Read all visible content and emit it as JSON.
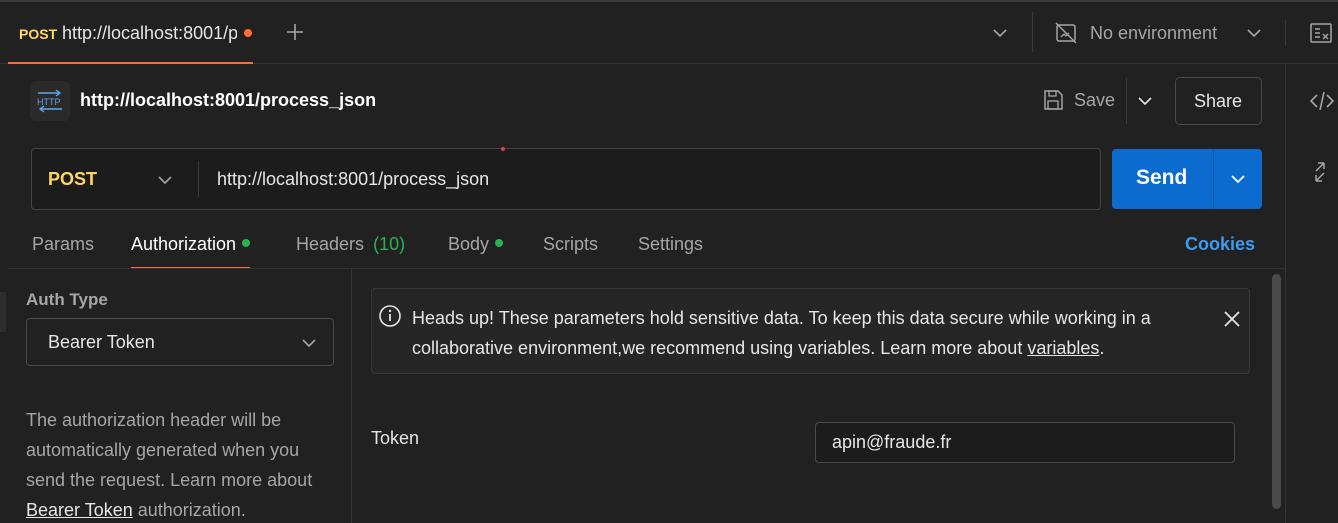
{
  "tabbar": {
    "tab_method": "POST",
    "tab_title": "http://localhost:8001/p",
    "environment_label": "No environment"
  },
  "request": {
    "title": "http://localhost:8001/process_json",
    "save_label": "Save",
    "share_label": "Share",
    "method": "POST",
    "url": "http://localhost:8001/process_json",
    "send_label": "Send"
  },
  "tabs": {
    "params": "Params",
    "authorization": "Authorization",
    "headers": "Headers",
    "headers_count": "(10)",
    "body": "Body",
    "scripts": "Scripts",
    "settings": "Settings",
    "cookies": "Cookies"
  },
  "auth": {
    "type_label": "Auth Type",
    "type_value": "Bearer Token",
    "desc_line1": "The authorization header will be",
    "desc_line2": "automatically generated when you",
    "desc_line3": "send the request. Learn more about",
    "desc_link": "Bearer Token",
    "desc_tail": " authorization."
  },
  "notice": {
    "line1": "Heads up! These parameters hold sensitive data. To keep this data secure while working in a",
    "line2": "collaborative environment,we recommend using variables. Learn more about ",
    "link": "variables",
    "end": "."
  },
  "token": {
    "label": "Token",
    "value": "apin@fraude.fr"
  },
  "colors": {
    "accent_orange": "#ff6c37",
    "send_blue": "#0b6bcf",
    "method_yellow": "#ffd666",
    "green_count": "#2bb24c",
    "cookies_blue": "#3d9bf0"
  },
  "icons": [
    "plus-icon",
    "chevron-down-icon",
    "no-environment-icon",
    "environment-quick-look-icon",
    "http-icon",
    "save-icon",
    "code-icon",
    "info-circle-icon",
    "close-icon",
    "related-collections-icon"
  ]
}
